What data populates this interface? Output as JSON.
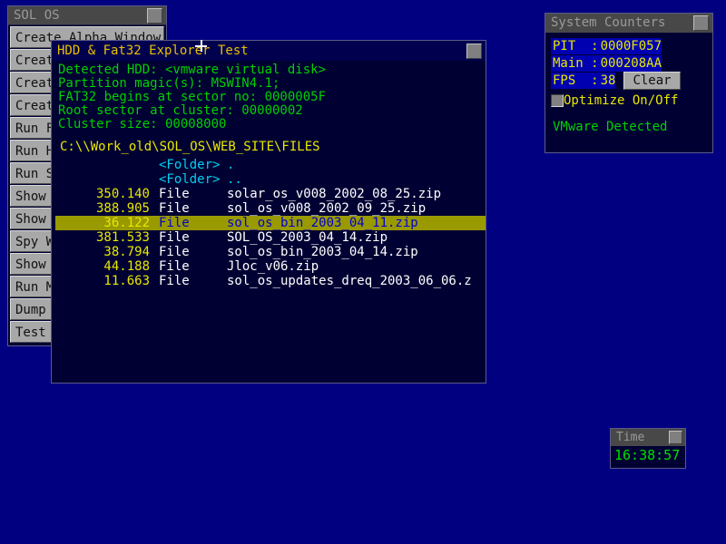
{
  "desktop": {
    "background_color": "#000080"
  },
  "sol_os_window": {
    "title": "SOL OS",
    "close_button": "close-box",
    "menu_items": [
      {
        "label": "Create Alpha Window"
      },
      {
        "label": "Create Window"
      },
      {
        "label": "Create Button"
      },
      {
        "label": "Create Text"
      },
      {
        "label": "Run FDD Test"
      },
      {
        "label": "Run HDD Test"
      },
      {
        "label": "Run Sample App"
      },
      {
        "label": "Show SYS Counters"
      },
      {
        "label": "Show KBD Queue"
      },
      {
        "label": "Spy Windows"
      },
      {
        "label": "Show Memory"
      },
      {
        "label": "Run Menu Test"
      },
      {
        "label": "Dump Memory"
      },
      {
        "label": "Test App"
      }
    ]
  },
  "hdd_explorer": {
    "title": "HDD & Fat32 Explorer Test",
    "close_button": "close-box",
    "info_lines": [
      "Detected HDD: <vmware virtual disk>",
      "Partition magic(s): MSWIN4.1;",
      "FAT32 begins at sector no: 0000005F",
      "Root sector at cluster: 00000002",
      "Cluster size: 00008000"
    ],
    "path": "C:\\\\Work_old\\SOL_OS\\WEB_SITE\\FILES",
    "files": [
      {
        "size": "",
        "type": "<Folder>",
        "name": ".",
        "kind": "folder",
        "selected": false
      },
      {
        "size": "",
        "type": "<Folder>",
        "name": "..",
        "kind": "folder",
        "selected": false
      },
      {
        "size": "350.140",
        "type": "File",
        "name": "solar_os_v008_2002_08_25.zip",
        "kind": "file",
        "selected": false
      },
      {
        "size": "388.905",
        "type": "File",
        "name": "sol_os_v008_2002_09_25.zip",
        "kind": "file",
        "selected": false
      },
      {
        "size": "36.122",
        "type": "File",
        "name": "sol_os_bin_2003_04_11.zip",
        "kind": "file",
        "selected": true
      },
      {
        "size": "381.533",
        "type": "File",
        "name": "SOL_OS_2003_04_14.zip",
        "kind": "file",
        "selected": false
      },
      {
        "size": "38.794",
        "type": "File",
        "name": "sol_os_bin_2003_04_14.zip",
        "kind": "file",
        "selected": false
      },
      {
        "size": "44.188",
        "type": "File",
        "name": "Jloc_v06.zip",
        "kind": "file",
        "selected": false
      },
      {
        "size": "11.663",
        "type": "File",
        "name": "sol_os_updates_dreq_2003_06_06.z",
        "kind": "file",
        "selected": false
      }
    ]
  },
  "system_counters": {
    "title": "System Counters",
    "close_button": "close-box",
    "counters": [
      {
        "label": "PIT  :",
        "value": "0000F057"
      },
      {
        "label": "Main :",
        "value": "000208AA"
      },
      {
        "label": "FPS  :",
        "value": "38"
      }
    ],
    "clear_button": "Clear",
    "optimize_label": "Optimize On/Off",
    "optimize_checked": false,
    "status": "VMware Detected"
  },
  "time_window": {
    "title": "Time",
    "close_button": "close-box",
    "value": "16:38:57"
  }
}
